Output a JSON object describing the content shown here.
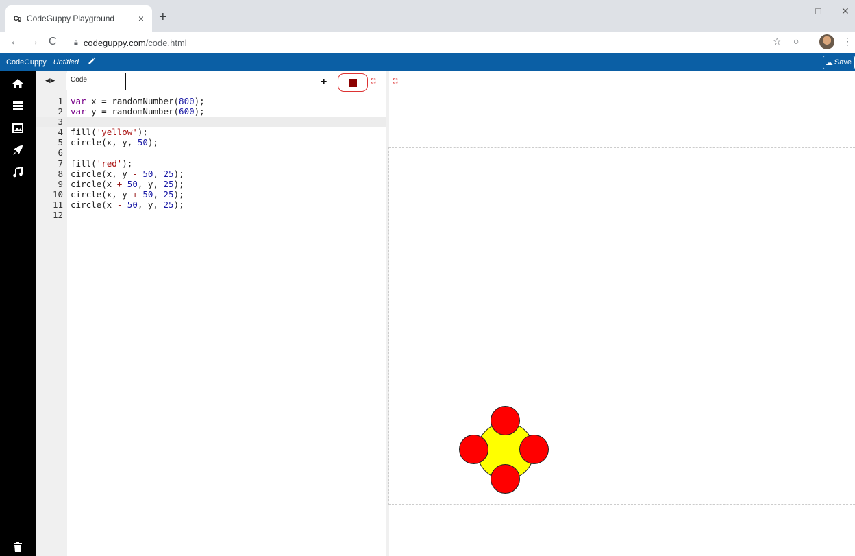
{
  "browser": {
    "tab_title": "CodeGuppy Playground",
    "tab_favicon": "Cg",
    "tab_close": "×",
    "new_tab": "+",
    "url_host": "codeguppy.com",
    "url_path": "/code.html",
    "window_controls": [
      "–",
      "□",
      "✕"
    ]
  },
  "app": {
    "brand": "CodeGuppy",
    "filename": "Untitled",
    "save_label": "Save",
    "accent": "#0b5fa5"
  },
  "sidebar": {
    "icons": [
      "home-icon",
      "menu-icon",
      "image-icon",
      "rocket-icon",
      "music-icon",
      "trash-icon"
    ]
  },
  "editor": {
    "tab_label": "Code",
    "add_label": "+",
    "lines": [
      {
        "n": "1"
      },
      {
        "n": "2"
      },
      {
        "n": "3"
      },
      {
        "n": "4"
      },
      {
        "n": "5"
      },
      {
        "n": "6"
      },
      {
        "n": "7"
      },
      {
        "n": "8"
      },
      {
        "n": "9"
      },
      {
        "n": "10"
      },
      {
        "n": "11"
      },
      {
        "n": "12"
      }
    ],
    "code": [
      "var x = randomNumber(800);",
      "var y = randomNumber(600);",
      "",
      "fill('yellow');",
      "circle(x, y, 50);",
      "",
      "fill('red');",
      "circle(x, y - 50, 25);",
      "circle(x + 50, y, 25);",
      "circle(x, y + 50, 25);",
      "circle(x - 50, y, 25);",
      ""
    ]
  },
  "output": {
    "colors": {
      "center": "#ffff00",
      "petal": "#ff0000"
    }
  }
}
